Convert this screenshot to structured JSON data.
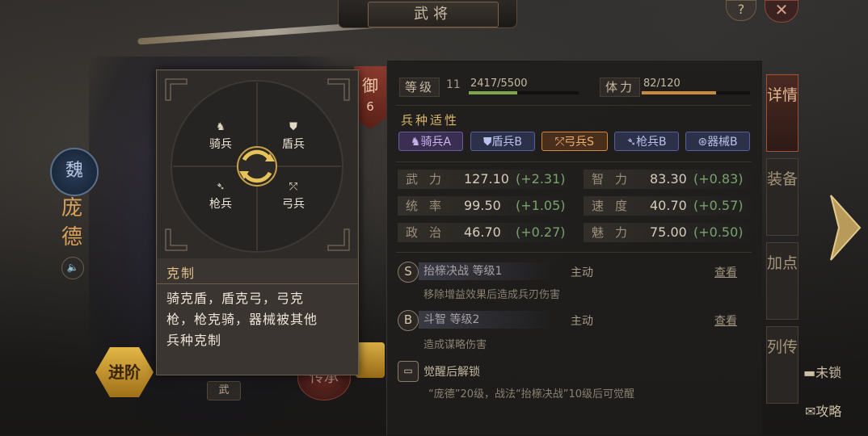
{
  "header": {
    "title": "武将",
    "help_label": "?",
    "close_label": "✕"
  },
  "hero": {
    "kingdom": "魏",
    "name": "庞德",
    "defense_char": "御",
    "defense_num": "6",
    "advance_label": "进阶",
    "wu_tab": "武",
    "legacy_label": "传承"
  },
  "level": {
    "label": "等级",
    "value": "11",
    "exp": "2417/5500",
    "exp_fraction": 0.44
  },
  "stamina": {
    "label": "体力",
    "value": "82/120",
    "fraction": 0.683
  },
  "affinity": {
    "title": "兵种适性",
    "chips": [
      {
        "label": "骑兵A",
        "icon": "♞"
      },
      {
        "label": "盾兵B",
        "icon": "⛊"
      },
      {
        "label": "弓兵S",
        "icon": "⤱"
      },
      {
        "label": "枪兵B",
        "icon": "➴"
      },
      {
        "label": "器械B",
        "icon": "⊛"
      }
    ]
  },
  "stats": [
    {
      "name": "武力",
      "value": "127.10",
      "bonus": "(+2.31)"
    },
    {
      "name": "智力",
      "value": "83.30",
      "bonus": "(+0.83)"
    },
    {
      "name": "统率",
      "value": "99.50",
      "bonus": "(+1.05)"
    },
    {
      "name": "速度",
      "value": "40.70",
      "bonus": "(+0.57)"
    },
    {
      "name": "政治",
      "value": "46.70",
      "bonus": "(+0.27)"
    },
    {
      "name": "魅力",
      "value": "75.00",
      "bonus": "(+0.50)"
    }
  ],
  "skills": [
    {
      "grade": "S",
      "name": "抬榇决战 等级1",
      "type": "主动",
      "view": "查看",
      "desc": "移除增益效果后造成兵刃伤害"
    },
    {
      "grade": "B",
      "name": "斗智 等级2",
      "type": "主动",
      "view": "查看",
      "desc": "造成谋略伤害"
    }
  ],
  "awaken": {
    "title": "觉醒后解锁",
    "desc": "“庞德”20级，战法“抬榇决战”10级后可觉醒"
  },
  "side_tabs": [
    "详情",
    "装备",
    "加点",
    "列传"
  ],
  "links": {
    "lock": "未锁",
    "guide": "攻略"
  },
  "tooltip": {
    "units": {
      "cavalry": "骑兵",
      "shield": "盾兵",
      "spear": "枪兵",
      "bow": "弓兵"
    },
    "title": "克制",
    "lines": [
      "骑克盾，盾克弓，弓克",
      "枪，枪克骑，器械被其他",
      "兵种克制"
    ]
  },
  "colors": {
    "accent_gold": "#d9b76a",
    "exp_bar": "#7aa84a",
    "stamina_bar": "#c98a3a",
    "bonus_green": "#78a36c",
    "hero_name": "#d9a15a"
  }
}
